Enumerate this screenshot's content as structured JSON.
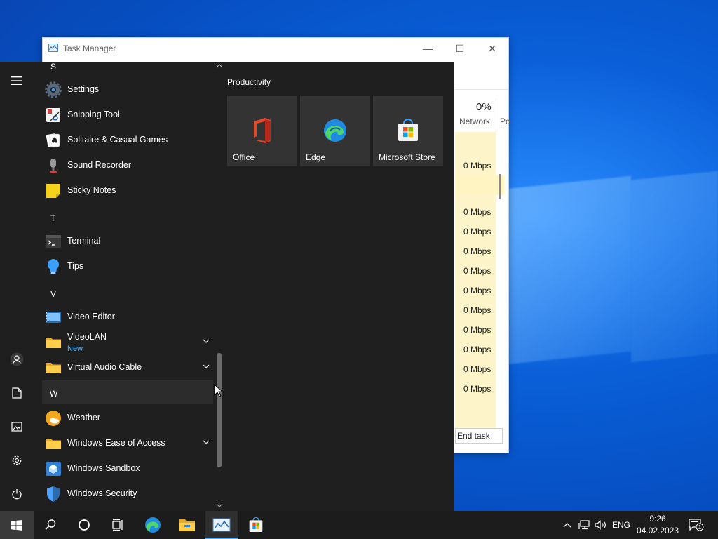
{
  "task_manager": {
    "title": "Task Manager",
    "network_percent": "0%",
    "network_label": "Network",
    "next_col_label": "Po",
    "rows": [
      "0 Mbps",
      "0 Mbps",
      "0 Mbps",
      "0 Mbps",
      "0 Mbps",
      "0 Mbps",
      "0 Mbps",
      "0 Mbps",
      "0 Mbps",
      "0 Mbps",
      "0 Mbps"
    ],
    "end_task_label": "End task"
  },
  "start_menu": {
    "letters": {
      "s": "S",
      "t": "T",
      "v": "V",
      "w": "W"
    },
    "apps": {
      "settings": "Settings",
      "snipping_tool": "Snipping Tool",
      "solitaire": "Solitaire & Casual Games",
      "sound_recorder": "Sound Recorder",
      "sticky_notes": "Sticky Notes",
      "terminal": "Terminal",
      "tips": "Tips",
      "video_editor": "Video Editor",
      "videolan": "VideoLAN",
      "videolan_badge": "New",
      "virtual_audio_cable": "Virtual Audio Cable",
      "weather": "Weather",
      "ease_of_access": "Windows Ease of Access",
      "sandbox": "Windows Sandbox",
      "security": "Windows Security"
    },
    "group_title": "Productivity",
    "tiles": [
      "Office",
      "Edge",
      "Microsoft Store"
    ]
  },
  "taskbar": {
    "language": "ENG",
    "time": "9:26",
    "date": "04.02.2023",
    "notification_count": "1"
  },
  "icons": [
    "windows-logo-icon",
    "search-icon",
    "cortana-icon",
    "task-view-icon",
    "edge-icon",
    "file-explorer-icon",
    "task-manager-icon",
    "store-icon"
  ]
}
